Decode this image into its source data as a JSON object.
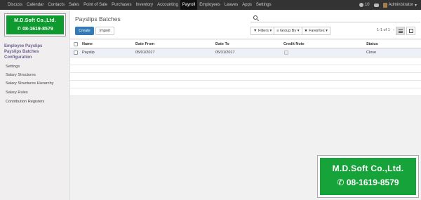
{
  "topbar": {
    "menu": [
      {
        "label": "Discuss",
        "active": false
      },
      {
        "label": "Calendar",
        "active": false
      },
      {
        "label": "Contacts",
        "active": false
      },
      {
        "label": "Sales",
        "active": false
      },
      {
        "label": "Point of Sale",
        "active": false
      },
      {
        "label": "Purchases",
        "active": false
      },
      {
        "label": "Inventory",
        "active": false
      },
      {
        "label": "Accounting",
        "active": false
      },
      {
        "label": "Payroll",
        "active": true
      },
      {
        "label": "Employees",
        "active": false
      },
      {
        "label": "Leaves",
        "active": false
      },
      {
        "label": "Apps",
        "active": false
      },
      {
        "label": "Settings",
        "active": false
      }
    ],
    "notification_count": "10",
    "user": "Administrator",
    "user_caret": "▾"
  },
  "logo": {
    "company": "M.D.Soft Co.,Ltd.",
    "phone": "08-1619-8579",
    "phone_icon": "✆"
  },
  "sidebar": {
    "headers": [
      "Employee Payslips",
      "Payslips Batches",
      "Configuration"
    ],
    "items": [
      "Settings",
      "Salary Structures",
      "Salary Structures Hierarchy",
      "Salary Rules",
      "Contribution Registers"
    ]
  },
  "control": {
    "title": "Payslips Batches",
    "create_label": "Create",
    "import_label": "Import",
    "search_placeholder": "",
    "filters_label": "▼ Filters ▾",
    "groupby_label": "≡ Group By ▾",
    "favorites_label": "★ Favorites ▾",
    "pager": "1-1 of 1",
    "pager_prev": "‹",
    "pager_next": "›"
  },
  "table": {
    "columns": [
      "Name",
      "Date From",
      "Date To",
      "Credit Note",
      "Status"
    ],
    "rows": [
      {
        "name": "Payslip",
        "date_from": "05/01/2017",
        "date_to": "05/31/2017",
        "credit_note": false,
        "status": "Close"
      }
    ]
  },
  "colors": {
    "navbar": "#333333",
    "primary_button": "#337ab7",
    "logo_green": "#15a33a",
    "sidebar_header": "#6b5e8f"
  }
}
